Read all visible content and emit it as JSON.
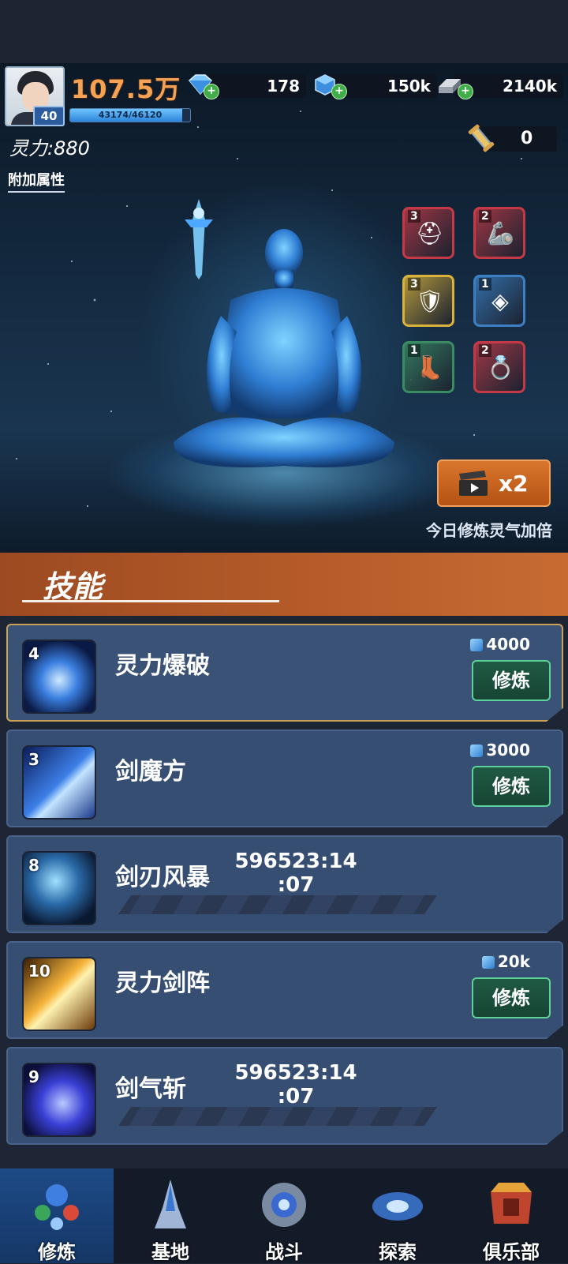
{
  "header": {
    "power": "107.5万",
    "level": "40",
    "xp_text": "43174/46120",
    "xp_fraction": 0.936,
    "resources": [
      {
        "name": "diamond",
        "value": "178"
      },
      {
        "name": "blue-cube",
        "value": "150k"
      },
      {
        "name": "metal-ingot",
        "value": "2140k"
      }
    ]
  },
  "cultivation": {
    "spirit_power": "灵力:880",
    "attr_link": "附加属性",
    "key_count": "0",
    "double_button_label": "x2",
    "double_note": "今日修炼灵气加倍",
    "equipment": [
      {
        "name": "helmet",
        "count": "3",
        "color": "#c33a46"
      },
      {
        "name": "gauntlet",
        "count": "2",
        "color": "#c33a46"
      },
      {
        "name": "armor",
        "count": "3",
        "color": "#d9b23b"
      },
      {
        "name": "belt",
        "count": "1",
        "color": "#3c7fc2"
      },
      {
        "name": "boots",
        "count": "1",
        "color": "#3a8a63"
      },
      {
        "name": "ring",
        "count": "2",
        "color": "#c33a46"
      }
    ]
  },
  "skills": {
    "title": "技能",
    "train_label": "修炼",
    "items": [
      {
        "level": "4",
        "name": "灵力爆破",
        "cost": "4000",
        "timer": null
      },
      {
        "level": "3",
        "name": "剑魔方",
        "cost": "3000",
        "timer": null
      },
      {
        "level": "8",
        "name": "剑刃风暴",
        "cost": null,
        "timer": "596523:14\n:07"
      },
      {
        "level": "10",
        "name": "灵力剑阵",
        "cost": "20k",
        "timer": null
      },
      {
        "level": "9",
        "name": "剑气斩",
        "cost": null,
        "timer": "596523:14\n:07"
      }
    ]
  },
  "nav": {
    "items": [
      {
        "label": "修炼",
        "active": true
      },
      {
        "label": "基地",
        "active": false
      },
      {
        "label": "战斗",
        "active": false
      },
      {
        "label": "探索",
        "active": false
      },
      {
        "label": "俱乐部",
        "active": false
      }
    ]
  }
}
